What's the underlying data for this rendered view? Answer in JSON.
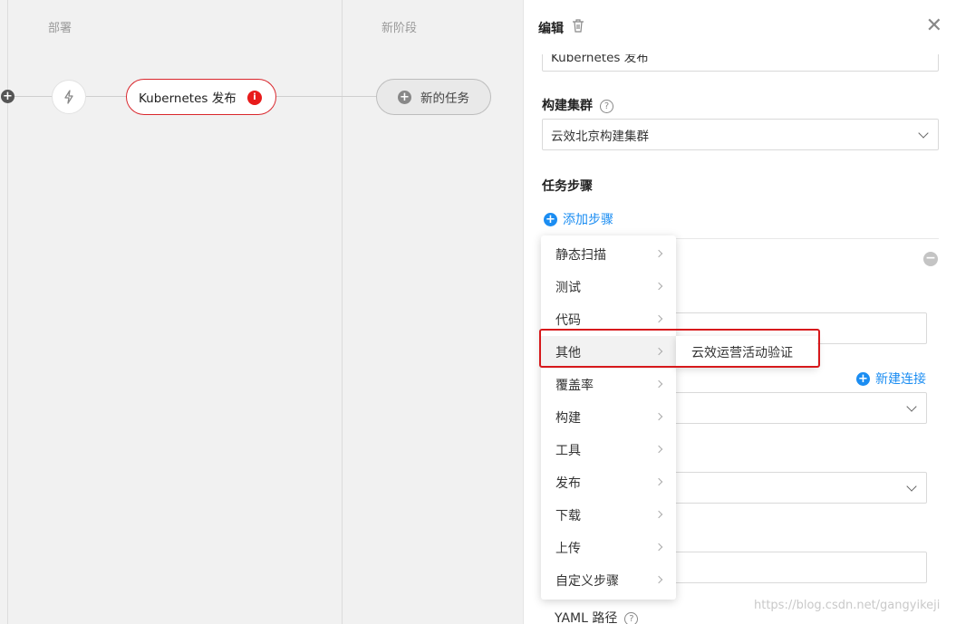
{
  "pipeline": {
    "stage_deploy": "部署",
    "stage_new": "新阶段",
    "task_name": "Kubernetes 发布",
    "error_badge": "i",
    "new_task": "新的任务"
  },
  "panel": {
    "title": "编辑",
    "task_name_value": "Kubernetes 发布",
    "cluster_label": "构建集群",
    "cluster_value": "云效北京构建集群",
    "steps_label": "任务步骤",
    "add_step": "添加步骤",
    "new_connection": "新建连接",
    "yaml_label": "YAML 路径"
  },
  "menu": {
    "items": [
      "静态扫描",
      "测试",
      "代码",
      "其他",
      "覆盖率",
      "构建",
      "工具",
      "发布",
      "下载",
      "上传",
      "自定义步骤"
    ],
    "active_index": 3,
    "submenu_item": "云效运营活动验证"
  },
  "watermark": "https://blog.csdn.net/gangyikeji",
  "colors": {
    "accent": "#1b8df2",
    "error": "#d9262c",
    "highlight": "#d7191c"
  },
  "icons": [
    "plus-icon",
    "lightning-icon",
    "info-icon",
    "trash-icon",
    "close-icon",
    "help-icon",
    "chevron-down-icon",
    "chevron-right-icon",
    "minus-icon"
  ]
}
